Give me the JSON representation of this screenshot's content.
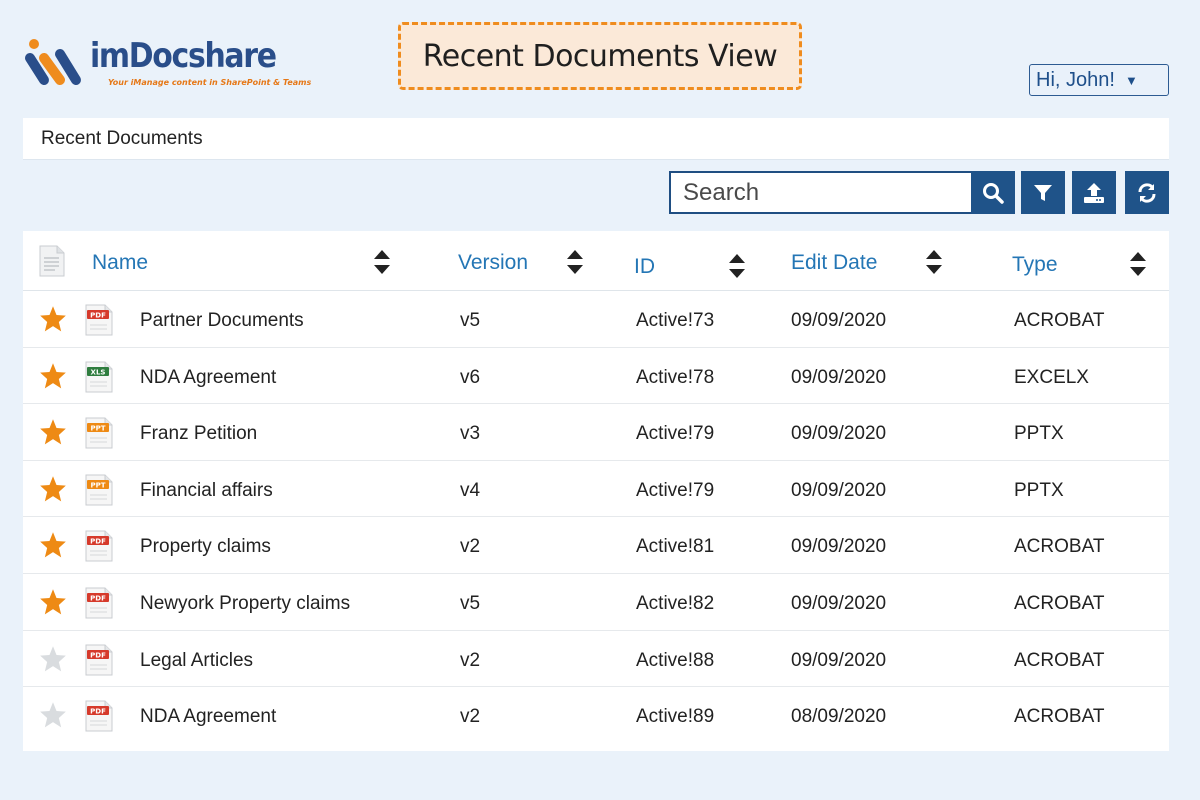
{
  "logo": {
    "name": "imDocshare",
    "tagline": "Your iManage content in SharePoint & Teams"
  },
  "view_title": "Recent Documents View",
  "user_menu": {
    "label": "Hi, John!"
  },
  "section": {
    "title": "Recent Documents"
  },
  "search": {
    "placeholder": "Search"
  },
  "toolbar": {
    "icons": [
      "search-icon",
      "filter-icon",
      "upload-icon",
      "refresh-icon"
    ]
  },
  "table": {
    "columns": [
      "Name",
      "Version",
      "ID",
      "Edit Date",
      "Type"
    ],
    "rows": [
      {
        "favorite": true,
        "file_badge": "PDF",
        "name": "Partner Documents",
        "version": "v5",
        "id": "Active!73",
        "edit_date": "09/09/2020",
        "type": "ACROBAT"
      },
      {
        "favorite": true,
        "file_badge": "XLS",
        "name": "NDA Agreement",
        "version": "v6",
        "id": "Active!78",
        "edit_date": "09/09/2020",
        "type": "EXCELX"
      },
      {
        "favorite": true,
        "file_badge": "PPT",
        "name": "Franz Petition",
        "version": "v3",
        "id": "Active!79",
        "edit_date": "09/09/2020",
        "type": "PPTX"
      },
      {
        "favorite": true,
        "file_badge": "PPT",
        "name": "Financial affairs",
        "version": "v4",
        "id": "Active!79",
        "edit_date": "09/09/2020",
        "type": "PPTX"
      },
      {
        "favorite": true,
        "file_badge": "PDF",
        "name": "Property claims",
        "version": "v2",
        "id": "Active!81",
        "edit_date": "09/09/2020",
        "type": "ACROBAT"
      },
      {
        "favorite": true,
        "file_badge": "PDF",
        "name": "Newyork Property claims",
        "version": "v5",
        "id": "Active!82",
        "edit_date": "09/09/2020",
        "type": "ACROBAT"
      },
      {
        "favorite": false,
        "file_badge": "PDF",
        "name": "Legal Articles",
        "version": "v2",
        "id": "Active!88",
        "edit_date": "09/09/2020",
        "type": "ACROBAT"
      },
      {
        "favorite": false,
        "file_badge": "PDF",
        "name": "NDA Agreement",
        "version": "v2",
        "id": "Active!89",
        "edit_date": "08/09/2020",
        "type": "ACROBAT"
      }
    ]
  },
  "colors": {
    "accent_blue": "#1f5389",
    "header_text": "#2476b5",
    "star_on": "#ee8a14",
    "star_off": "#d9dcdf",
    "pdf_badge": "#d63a2b",
    "xls_badge": "#2f7d3f",
    "ppt_badge": "#ee8a14",
    "title_border": "#ef8c1e",
    "title_fill": "#fbe9d8"
  }
}
